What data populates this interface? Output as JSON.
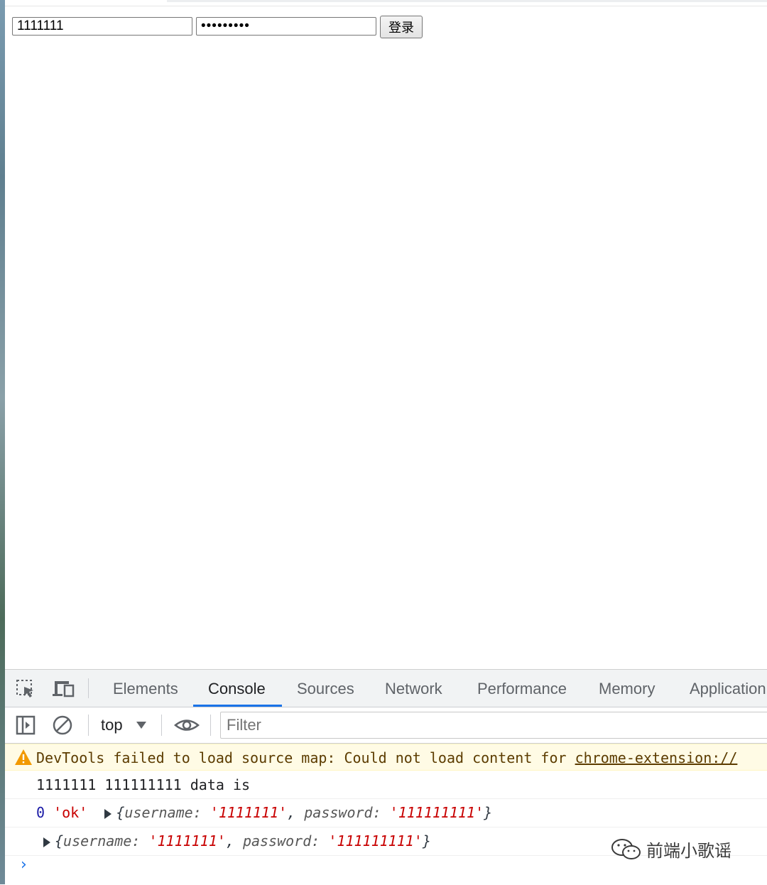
{
  "page": {
    "username_value": "1111111",
    "password_value": "•••••••••",
    "login_label": "登录"
  },
  "devtools": {
    "tabs": [
      {
        "label": "Elements"
      },
      {
        "label": "Console"
      },
      {
        "label": "Sources"
      },
      {
        "label": "Network"
      },
      {
        "label": "Performance"
      },
      {
        "label": "Memory"
      },
      {
        "label": "Application"
      }
    ],
    "active_tab": "Console",
    "toolbar": {
      "context": "top",
      "filter_placeholder": "Filter"
    },
    "console": {
      "warning_prefix": "DevTools failed to load source map: Could not load content for ",
      "warning_link": "chrome-extension://",
      "log1": "1111111 111111111 data is",
      "log2": {
        "num": "0",
        "str": "'ok'",
        "obj_open": "{",
        "k1": "username: ",
        "v1": "'1111111'",
        "sep": ", ",
        "k2": "password: ",
        "v2": "'111111111'",
        "obj_close": "}"
      },
      "log3": {
        "obj_open": "{",
        "k1": "username: ",
        "v1": "'1111111'",
        "sep": ", ",
        "k2": "password: ",
        "v2": "'111111111'",
        "obj_close": "}"
      },
      "prompt": "›"
    }
  },
  "watermark": {
    "text": "前端小歌谣",
    "icon": "wechat-icon"
  },
  "colors": {
    "accent": "#1a73e8",
    "warning_bg": "#fffbe5",
    "string": "#c80000",
    "number": "#1a1aa6"
  }
}
